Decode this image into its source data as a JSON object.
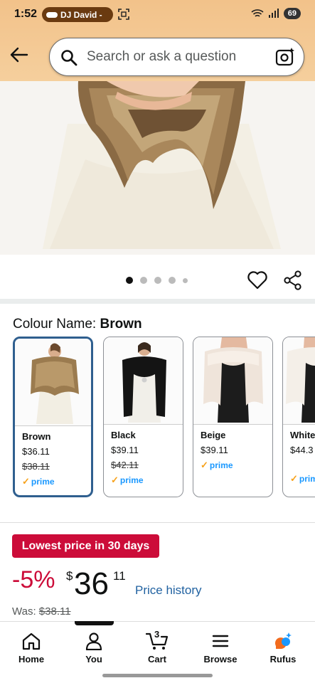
{
  "status": {
    "time": "1:52",
    "pill_text": "DJ David -",
    "battery": "69"
  },
  "search": {
    "placeholder": "Search or ask a question"
  },
  "carousel": {
    "dot_count": 5,
    "active_index": 0
  },
  "colour": {
    "label": "Colour Name:",
    "selected": "Brown",
    "options": [
      {
        "name": "Brown",
        "price": "$36.11",
        "was": "$38.11",
        "prime": "prime"
      },
      {
        "name": "Black",
        "price": "$39.11",
        "was": "$42.11",
        "prime": "prime"
      },
      {
        "name": "Beige",
        "price": "$39.11",
        "was": "",
        "prime": "prime"
      },
      {
        "name": "White",
        "price": "$44.3",
        "was": "",
        "prime": "prim"
      }
    ]
  },
  "deal": {
    "badge": "Lowest price in 30 days",
    "discount": "-5%",
    "currency": "$",
    "whole": "36",
    "fraction": "11",
    "history_link": "Price history",
    "was_label": "Was:",
    "was_price": "$38.11"
  },
  "nav": {
    "home": "Home",
    "you": "You",
    "cart": "Cart",
    "cart_count": "3",
    "browse": "Browse",
    "rufus": "Rufus"
  },
  "colors": {
    "header": "#f2c28a",
    "deal_red": "#cc0c39",
    "link_blue": "#2162a1",
    "selected_border": "#2f5f8f"
  }
}
